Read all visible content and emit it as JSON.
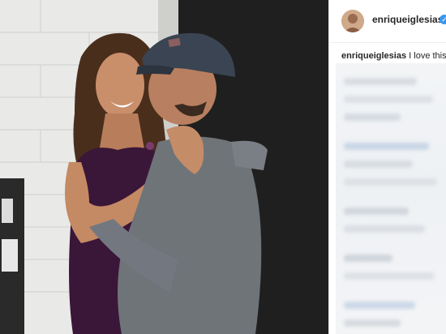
{
  "post": {
    "username": "enriqueiglesias",
    "verified_badge": "✓",
    "caption_user": "enriqueiglesias",
    "caption_text": "I love this phot"
  },
  "icons": {
    "verified": "verified-badge-icon"
  },
  "colors": {
    "verified_blue": "#3897f0",
    "text": "#262626",
    "photo_background": "#1e1e1e"
  }
}
